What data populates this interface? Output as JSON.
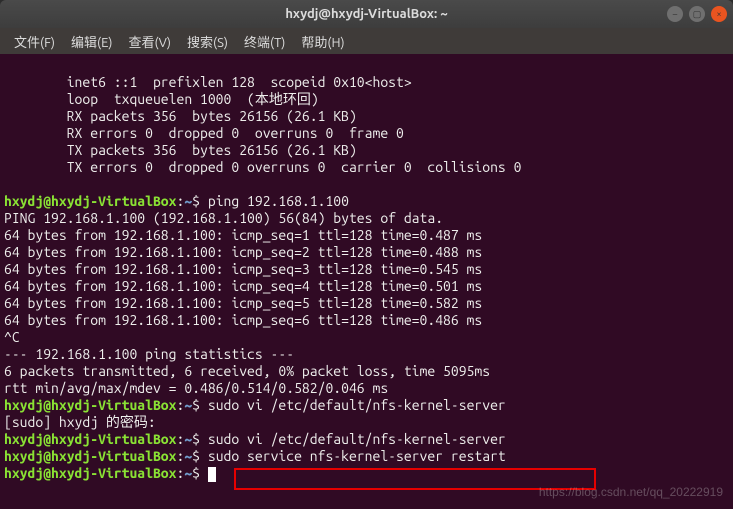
{
  "window": {
    "title": "hxydj@hxydj-VirtualBox: ~"
  },
  "menubar": {
    "file": "文件(F)",
    "edit": "编辑(E)",
    "view": "查看(V)",
    "search": "搜索(S)",
    "terminal": "终端(T)",
    "help": "帮助(H)"
  },
  "terminal": {
    "lines": {
      "l1": "        inet6 ::1  prefixlen 128  scopeid 0x10<host>",
      "l2": "        loop  txqueuelen 1000  (本地环回)",
      "l3": "        RX packets 356  bytes 26156 (26.1 KB)",
      "l4": "        RX errors 0  dropped 0  overruns 0  frame 0",
      "l5": "        TX packets 356  bytes 26156 (26.1 KB)",
      "l6": "        TX errors 0  dropped 0 overruns 0  carrier 0  collisions 0",
      "l7": "",
      "prompt_user": "hxydj@hxydj-VirtualBox",
      "prompt_sep": ":",
      "prompt_path": "~",
      "prompt_end": "$",
      "cmd1": " ping 192.168.1.100",
      "ping_header": "PING 192.168.1.100 (192.168.1.100) 56(84) bytes of data.",
      "ping1": "64 bytes from 192.168.1.100: icmp_seq=1 ttl=128 time=0.487 ms",
      "ping2": "64 bytes from 192.168.1.100: icmp_seq=2 ttl=128 time=0.488 ms",
      "ping3": "64 bytes from 192.168.1.100: icmp_seq=3 ttl=128 time=0.545 ms",
      "ping4": "64 bytes from 192.168.1.100: icmp_seq=4 ttl=128 time=0.501 ms",
      "ping5": "64 bytes from 192.168.1.100: icmp_seq=5 ttl=128 time=0.582 ms",
      "ping6": "64 bytes from 192.168.1.100: icmp_seq=6 ttl=128 time=0.486 ms",
      "ctrlc": "^C",
      "stats_header": "--- 192.168.1.100 ping statistics ---",
      "stats1": "6 packets transmitted, 6 received, 0% packet loss, time 5095ms",
      "stats2": "rtt min/avg/max/mdev = 0.486/0.514/0.582/0.046 ms",
      "cmd2": " sudo vi /etc/default/nfs-kernel-server",
      "sudo_prompt": "[sudo] hxydj 的密码:",
      "cmd3": " sudo vi /etc/default/nfs-kernel-server",
      "cmd4": " sudo service nfs-kernel-server restart",
      "cmd5": " "
    }
  },
  "watermark": "https://blog.csdn.net/qq_20222919"
}
